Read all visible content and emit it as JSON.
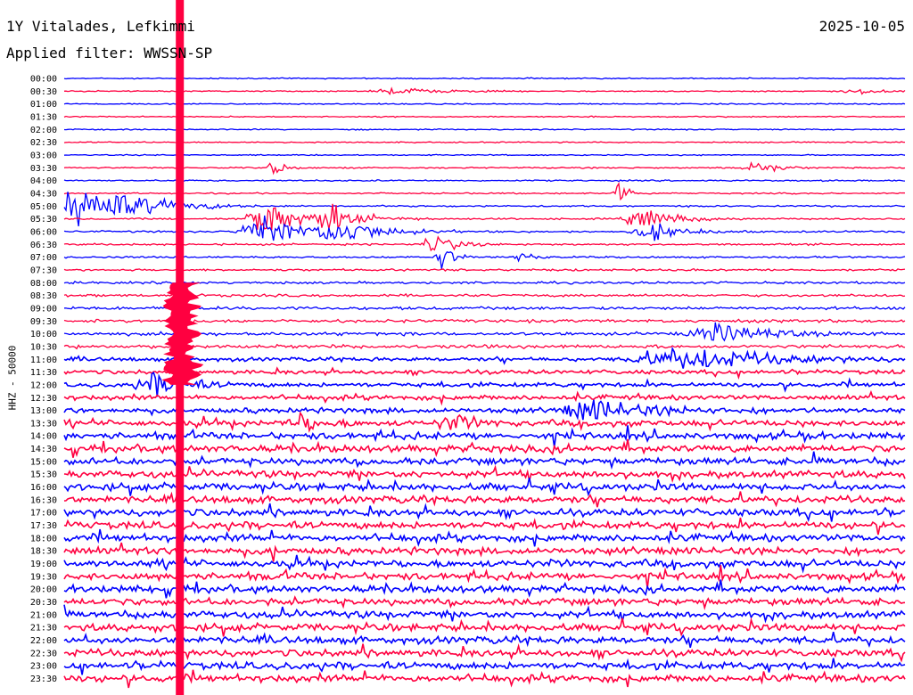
{
  "header": {
    "station": "1Y Vitalades, Lefkimmi",
    "date": "2025-10-05",
    "filter": "Applied filter: WWSSN-SP"
  },
  "chart_data": {
    "type": "line",
    "title": "1Y Vitalades, Lefkimmi",
    "ylabel": "HHZ - 50000",
    "rows": [
      "00:00",
      "00:30",
      "01:00",
      "01:30",
      "02:00",
      "02:30",
      "03:00",
      "03:30",
      "04:00",
      "04:30",
      "05:00",
      "05:30",
      "06:00",
      "06:30",
      "07:00",
      "07:30",
      "08:00",
      "08:30",
      "09:00",
      "09:30",
      "10:00",
      "10:30",
      "11:00",
      "11:30",
      "12:00",
      "12:30",
      "13:00",
      "13:30",
      "14:00",
      "14:30",
      "15:00",
      "15:30",
      "16:00",
      "16:30",
      "17:00",
      "17:30",
      "18:00",
      "18:30",
      "19:00",
      "19:30",
      "20:00",
      "20:30",
      "21:00",
      "21:30",
      "22:00",
      "22:30",
      "23:00",
      "23:30"
    ],
    "trace_colors": [
      "#0000ff",
      "#ff0040"
    ],
    "row_duration_minutes": 30,
    "noise_amplitude": [
      0.5,
      0.5,
      0.5,
      0.5,
      0.5,
      0.5,
      0.5,
      0.6,
      0.6,
      0.6,
      0.7,
      0.7,
      0.8,
      0.8,
      0.8,
      0.9,
      1.0,
      1.1,
      1.3,
      1.3,
      1.4,
      1.5,
      1.6,
      1.7,
      1.8,
      2.0,
      2.2,
      2.5,
      2.8,
      3.0,
      3.0,
      3.0,
      3.0,
      3.0,
      3.0,
      3.0,
      3.0,
      3.0,
      3.0,
      3.0,
      3.0,
      3.0,
      3.0,
      3.0,
      3.0,
      3.0,
      3.0,
      3.0
    ],
    "events": [
      {
        "row": 1,
        "t": 0.4,
        "amp": 3,
        "dur": 0.04
      },
      {
        "row": 1,
        "t": 0.95,
        "amp": 2,
        "dur": 0.03
      },
      {
        "row": 7,
        "t": 0.25,
        "amp": 8,
        "dur": 0.01
      },
      {
        "row": 7,
        "t": 0.82,
        "amp": 7,
        "dur": 0.02
      },
      {
        "row": 9,
        "t": 0.66,
        "amp": 12,
        "dur": 0.01
      },
      {
        "row": 10,
        "t": 0.03,
        "amp": 22,
        "dur": 0.05
      },
      {
        "row": 11,
        "t": 0.24,
        "amp": 18,
        "dur": 0.03
      },
      {
        "row": 11,
        "t": 0.32,
        "amp": 12,
        "dur": 0.03
      },
      {
        "row": 11,
        "t": 0.69,
        "amp": 10,
        "dur": 0.03
      },
      {
        "row": 12,
        "t": 0.24,
        "amp": 14,
        "dur": 0.04
      },
      {
        "row": 12,
        "t": 0.33,
        "amp": 10,
        "dur": 0.04
      },
      {
        "row": 12,
        "t": 0.7,
        "amp": 8,
        "dur": 0.03
      },
      {
        "row": 13,
        "t": 0.44,
        "amp": 10,
        "dur": 0.02
      },
      {
        "row": 14,
        "t": 0.45,
        "amp": 12,
        "dur": 0.01
      },
      {
        "row": 14,
        "t": 0.54,
        "amp": 8,
        "dur": 0.01
      },
      {
        "row": 20,
        "t": 0.78,
        "amp": 8,
        "dur": 0.05
      },
      {
        "row": 22,
        "t": 0.74,
        "amp": 10,
        "dur": 0.08
      },
      {
        "row": 24,
        "t": 0.11,
        "amp": 10,
        "dur": 0.03
      },
      {
        "row": 26,
        "t": 0.63,
        "amp": 9,
        "dur": 0.05
      },
      {
        "row": 27,
        "t": 0.46,
        "amp": 8,
        "dur": 0.02
      },
      {
        "row": 27,
        "t": 0.28,
        "amp": 8,
        "dur": 0.02
      }
    ],
    "saturated_event": {
      "row_start": 0,
      "row_end": 47,
      "t": 0.137
    }
  }
}
